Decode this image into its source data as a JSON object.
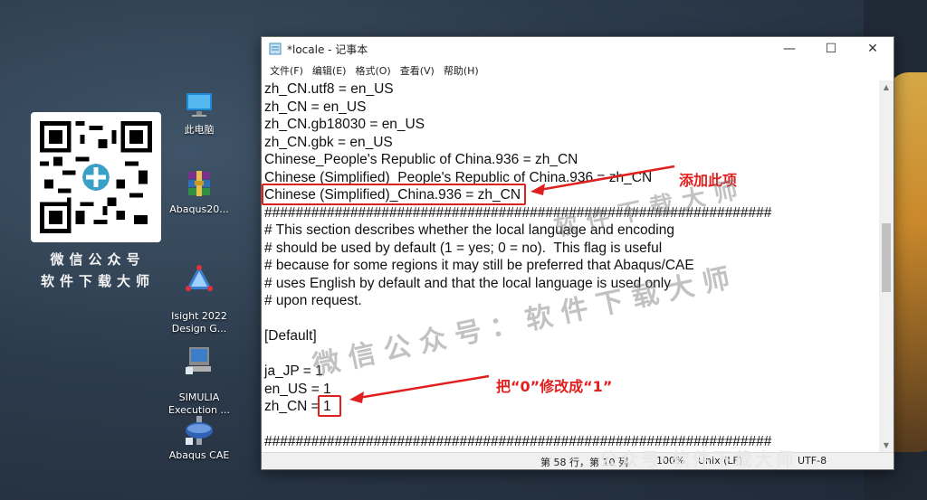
{
  "desktop": {
    "qr_caption_1": "微信公众号",
    "qr_caption_2": "软件下载大师",
    "icons": [
      {
        "label": "此电脑",
        "icon": "computer-icon"
      },
      {
        "label": "Abaqus20...",
        "icon": "winrar-icon"
      },
      {
        "label": "Isight 2022\nDesign G...",
        "icon": "isight-icon"
      },
      {
        "label": "SIMULIA\nExecution ...",
        "icon": "simulia-icon"
      },
      {
        "label": "Abaqus CAE",
        "icon": "abaqus-icon"
      }
    ]
  },
  "window": {
    "title": "*locale - 记事本",
    "menu": [
      "文件(F)",
      "编辑(E)",
      "格式(O)",
      "查看(V)",
      "帮助(H)"
    ],
    "controls": {
      "minimize": "—",
      "maximize": "☐",
      "close": "✕"
    },
    "lines": [
      "zh_CN.utf8 = en_US",
      "zh_CN = en_US",
      "zh_CN.gb18030 = en_US",
      "zh_CN.gbk = en_US",
      "Chinese_People's Republic of China.936 = zh_CN",
      "Chinese (Simplified)_People's Republic of China.936 = zh_CN",
      "Chinese (Simplified)_China.936 = zh_CN",
      "#################################################################",
      "# This section describes whether the local language and encoding",
      "# should be used by default (1 = yes; 0 = no).  This flag is useful",
      "# because for some regions it may still be preferred that Abaqus/CAE",
      "# uses English by default and that the local language is used only",
      "# upon request.",
      "",
      "[Default]",
      "",
      "ja_JP = 1",
      "en_US = 1",
      "zh_CN = 1",
      "",
      "#################################################################"
    ],
    "status": {
      "position": "第 58 行，第 10 列",
      "zoom": "100%",
      "line_ending": "Unix (LF)",
      "encoding": "UTF-8"
    }
  },
  "annotations": {
    "add_item": "添加此项",
    "change_value": "把“0”修改成“1”",
    "color": "#e0201e"
  },
  "watermarks": {
    "center_top": "软件下载大师",
    "center_mid": "微信公众号：软件下载大师",
    "bottom": "公众号·软件下载大师"
  }
}
